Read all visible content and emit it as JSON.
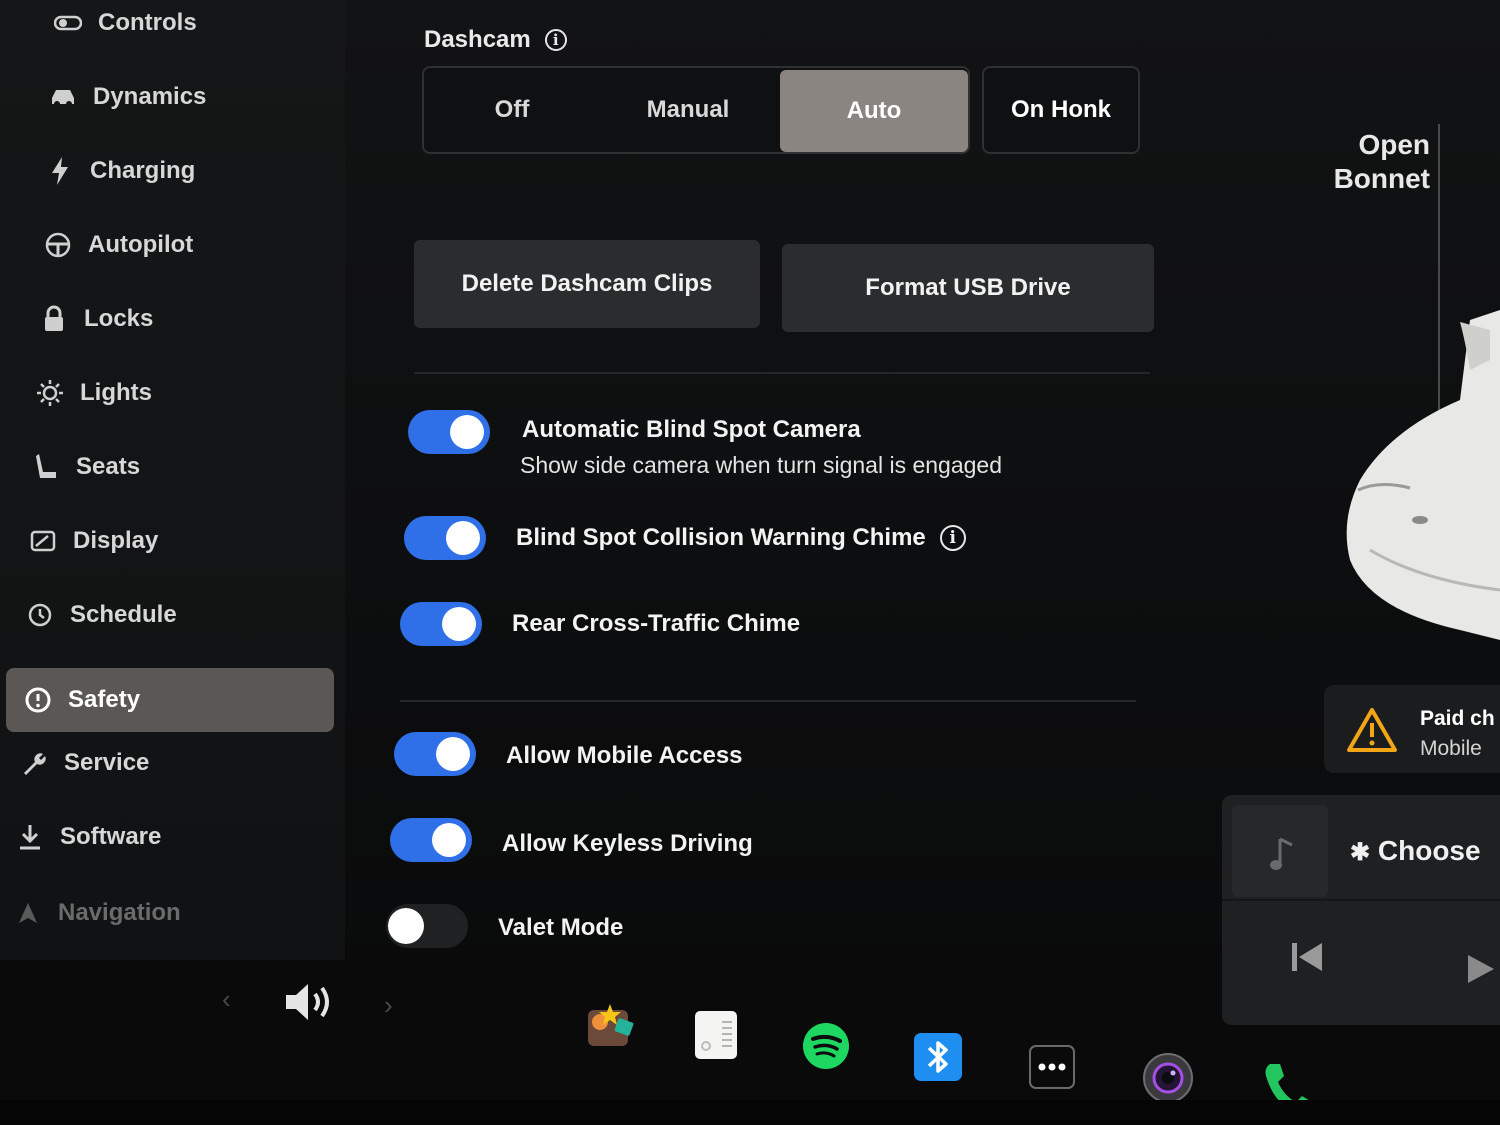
{
  "sidebar": {
    "items": [
      {
        "label": "Controls"
      },
      {
        "label": "Dynamics"
      },
      {
        "label": "Charging"
      },
      {
        "label": "Autopilot"
      },
      {
        "label": "Locks"
      },
      {
        "label": "Lights"
      },
      {
        "label": "Seats"
      },
      {
        "label": "Display"
      },
      {
        "label": "Schedule"
      },
      {
        "label": "Safety"
      },
      {
        "label": "Service"
      },
      {
        "label": "Software"
      },
      {
        "label": "Navigation"
      }
    ],
    "active": "Safety"
  },
  "dashcam": {
    "title": "Dashcam",
    "options": [
      "Off",
      "Manual",
      "Auto"
    ],
    "selected": "Auto",
    "on_honk": "On Honk"
  },
  "buttons": {
    "delete_clips": "Delete Dashcam Clips",
    "format_usb": "Format USB Drive"
  },
  "settings": [
    {
      "title": "Automatic Blind Spot Camera",
      "subtitle": "Show side camera when turn signal is engaged",
      "enabled": true
    },
    {
      "title": "Blind Spot Collision Warning Chime",
      "enabled": true,
      "info": true
    },
    {
      "title": "Rear Cross-Traffic Chime",
      "enabled": true
    },
    {
      "title": "Allow Mobile Access",
      "enabled": true
    },
    {
      "title": "Allow Keyless Driving",
      "enabled": true
    },
    {
      "title": "Valet Mode",
      "enabled": false
    }
  ],
  "right_panel": {
    "open_bonnet_line1": "Open",
    "open_bonnet_line2": "Bonnet",
    "alert_title": "Paid ch",
    "alert_sub": "Mobile",
    "media_choose": "Choose"
  },
  "dock": {
    "icons": [
      "volume-icon",
      "toybox-icon",
      "notes-icon",
      "spotify-icon",
      "bluetooth-icon",
      "more-icon",
      "camera-icon",
      "phone-icon"
    ]
  },
  "colors": {
    "toggle_on": "#2f6fe7",
    "selected_segment": "#8a8580",
    "active_nav": "#5a5754",
    "spotify": "#1ed760",
    "bluetooth": "#1f8ef1",
    "phone": "#22c55e"
  }
}
